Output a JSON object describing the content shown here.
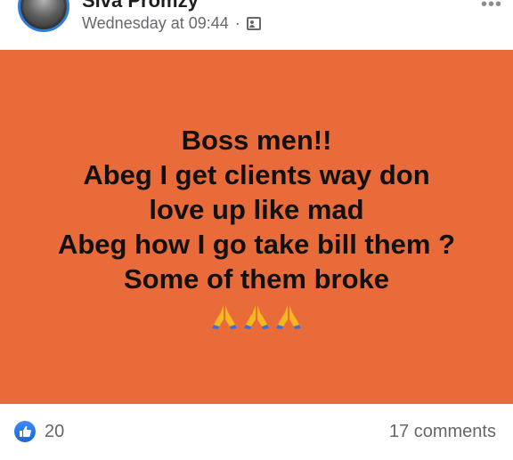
{
  "post": {
    "author": "Siva Promzy",
    "timestamp": "Wednesday at 09:44",
    "separator": "·",
    "audience_icon": "friends-icon",
    "text_lines": [
      "Boss men!!",
      "Abeg I get clients way don",
      "love up like mad",
      "Abeg how I go take bill them ?",
      "Some of them broke"
    ],
    "emoji": "🙏🙏🙏",
    "background_color": "#ea6b3a"
  },
  "reactions": {
    "icon": "like-icon",
    "count": "20"
  },
  "comments": {
    "label": "17 comments"
  },
  "colors": {
    "accent": "#1877f2",
    "secondary_text": "#65676b"
  }
}
